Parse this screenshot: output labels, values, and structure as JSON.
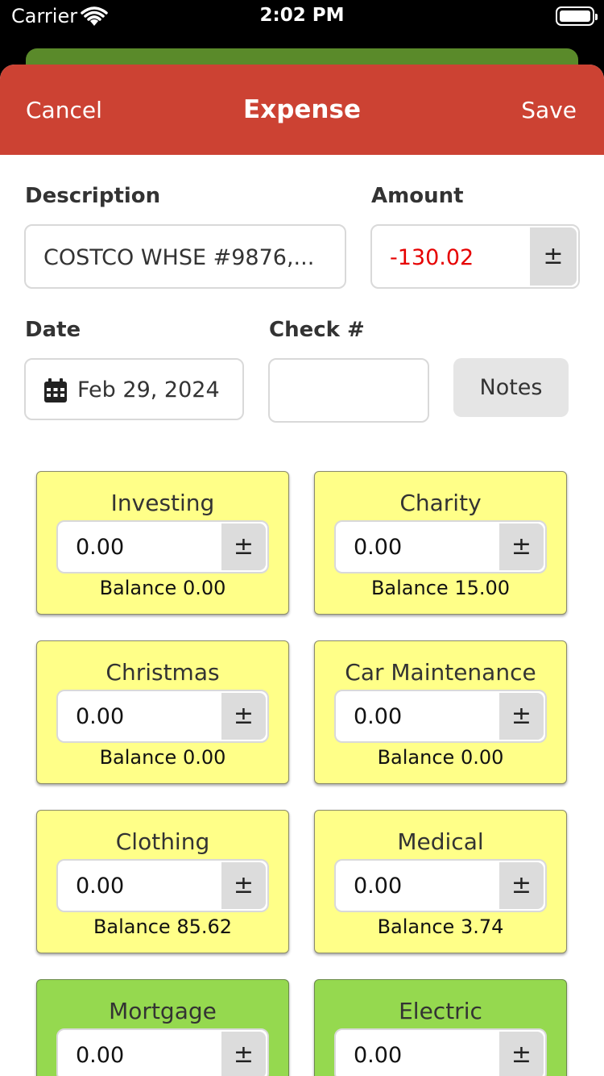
{
  "status_bar": {
    "carrier": "Carrier",
    "time": "2:02 PM"
  },
  "nav": {
    "cancel": "Cancel",
    "title": "Expense",
    "save": "Save"
  },
  "form": {
    "description_label": "Description",
    "description_value": "COSTCO WHSE #9876,...",
    "amount_label": "Amount",
    "amount_value": "-130.02",
    "amount_color": "#e60000",
    "date_label": "Date",
    "date_value": "Feb 29, 2024",
    "check_label": "Check #",
    "check_value": "",
    "notes_label": "Notes",
    "plus_minus": "±"
  },
  "categories": [
    {
      "name": "Investing",
      "amount": "0.00",
      "balance": "Balance 0.00",
      "color": "yellow"
    },
    {
      "name": "Charity",
      "amount": "0.00",
      "balance": "Balance 15.00",
      "color": "yellow"
    },
    {
      "name": "Christmas",
      "amount": "0.00",
      "balance": "Balance 0.00",
      "color": "yellow"
    },
    {
      "name": "Car Maintenance",
      "amount": "0.00",
      "balance": "Balance 0.00",
      "color": "yellow"
    },
    {
      "name": "Clothing",
      "amount": "0.00",
      "balance": "Balance 85.62",
      "color": "yellow"
    },
    {
      "name": "Medical",
      "amount": "0.00",
      "balance": "Balance 3.74",
      "color": "yellow"
    },
    {
      "name": "Mortgage",
      "amount": "0.00",
      "balance": "",
      "color": "green"
    },
    {
      "name": "Electric",
      "amount": "0.00",
      "balance": "",
      "color": "green"
    }
  ],
  "colors": {
    "nav": "#cc4233",
    "yellow": "#ffff88",
    "green": "#95d94f"
  }
}
